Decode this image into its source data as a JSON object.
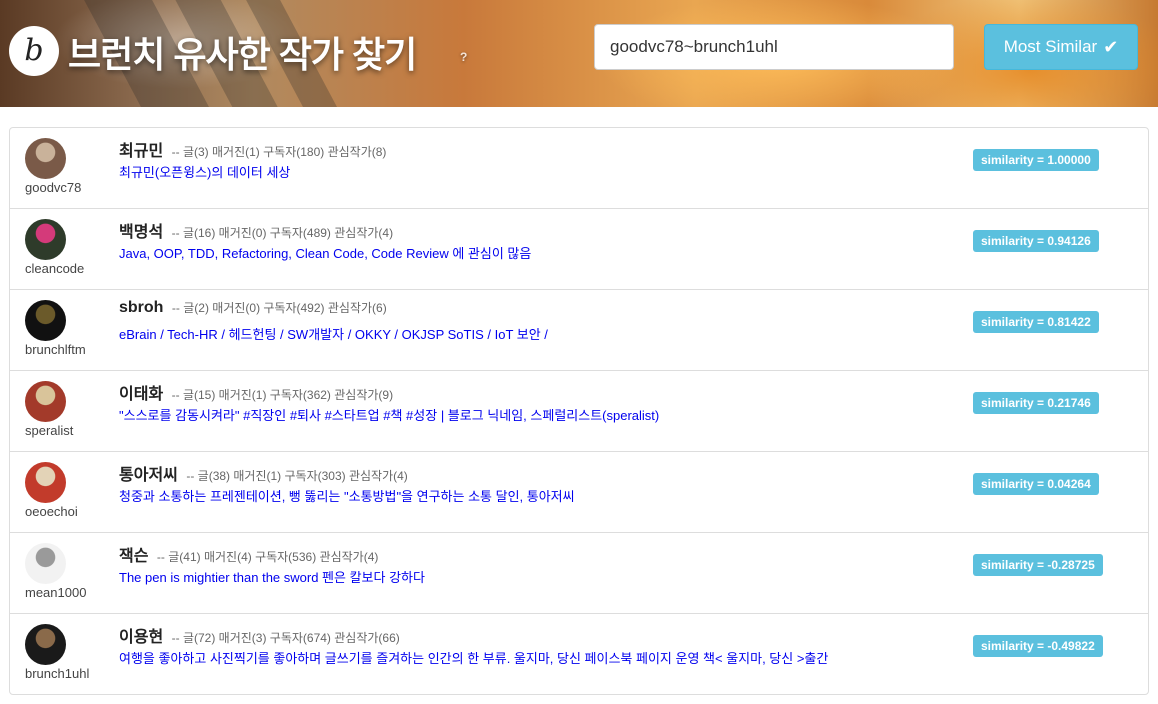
{
  "header": {
    "logo_glyph": "b",
    "title": "브런치 유사한 작가 찾기",
    "help_glyph": "?",
    "search_value": "goodvc78~brunch1uhl",
    "button_label": "Most Similar",
    "button_icon": "check-icon",
    "accent_color": "#5bc0de"
  },
  "authors": [
    {
      "uid": "goodvc78",
      "name": "최규민",
      "stats": "-- 글(3) 매거진(1) 구독자(180) 관심작가(8)",
      "desc": "최규민(오픈윙스)의 데이터 세상",
      "similarity": "similarity = 1.00000",
      "avatar_colors": [
        "#7a5a48",
        "#c9b29a"
      ]
    },
    {
      "uid": "cleancode",
      "name": "백명석",
      "stats": "-- 글(16) 매거진(0) 구독자(489) 관심작가(4)",
      "desc": "Java, OOP, TDD, Refactoring, Clean Code, Code Review 에 관심이 많음",
      "similarity": "similarity = 0.94126",
      "avatar_colors": [
        "#2e3b2a",
        "#d43a7a"
      ]
    },
    {
      "uid": "brunchlftm",
      "name": "sbroh",
      "stats": "-- 글(2) 매거진(0) 구독자(492) 관심작가(6)",
      "desc": "eBrain / Tech-HR / 헤드헌팅 / SW개발자 / OKKY / OKJSP SoTIS / IoT 보안 /",
      "similarity": "similarity = 0.81422",
      "avatar_colors": [
        "#111111",
        "#6b5a2a"
      ]
    },
    {
      "uid": "speralist",
      "name": "이태화",
      "stats": "-- 글(15) 매거진(1) 구독자(362) 관심작가(9)",
      "desc": "\"스스로를 감동시켜라\" #직장인 #퇴사 #스타트업 #책 #성장 | 블로그 닉네임, 스페럴리스트(speralist)",
      "similarity": "similarity = 0.21746",
      "avatar_colors": [
        "#a33a2a",
        "#d9c49a"
      ]
    },
    {
      "uid": "oeoechoi",
      "name": "통아저씨",
      "stats": "-- 글(38) 매거진(1) 구독자(303) 관심작가(4)",
      "desc": "청중과 소통하는 프레젠테이션, 뻥 뚫리는 \"소통방법\"을 연구하는 소통 달인, 통아저씨",
      "similarity": "similarity = 0.04264",
      "avatar_colors": [
        "#c23b2b",
        "#e3d3b7"
      ]
    },
    {
      "uid": "mean1000",
      "name": "잭슨",
      "stats": "-- 글(41) 매거진(4) 구독자(536) 관심작가(4)",
      "desc": "The pen is mightier than the sword 펜은 칼보다 강하다",
      "similarity": "similarity = -0.28725",
      "avatar_colors": [
        "#f2f2f2",
        "#9a9a9a"
      ]
    },
    {
      "uid": "brunch1uhl",
      "name": "이용현",
      "stats": "-- 글(72) 매거진(3) 구독자(674) 관심작가(66)",
      "desc": "여행을 좋아하고 사진찍기를 좋아하며 글쓰기를 즐겨하는 인간의 한 부류. 울지마, 당신 페이스북 페이지 운영 책< 울지마, 당신 >출간",
      "similarity": "similarity = -0.49822",
      "avatar_colors": [
        "#1a1a1a",
        "#8a6a4a"
      ]
    }
  ]
}
